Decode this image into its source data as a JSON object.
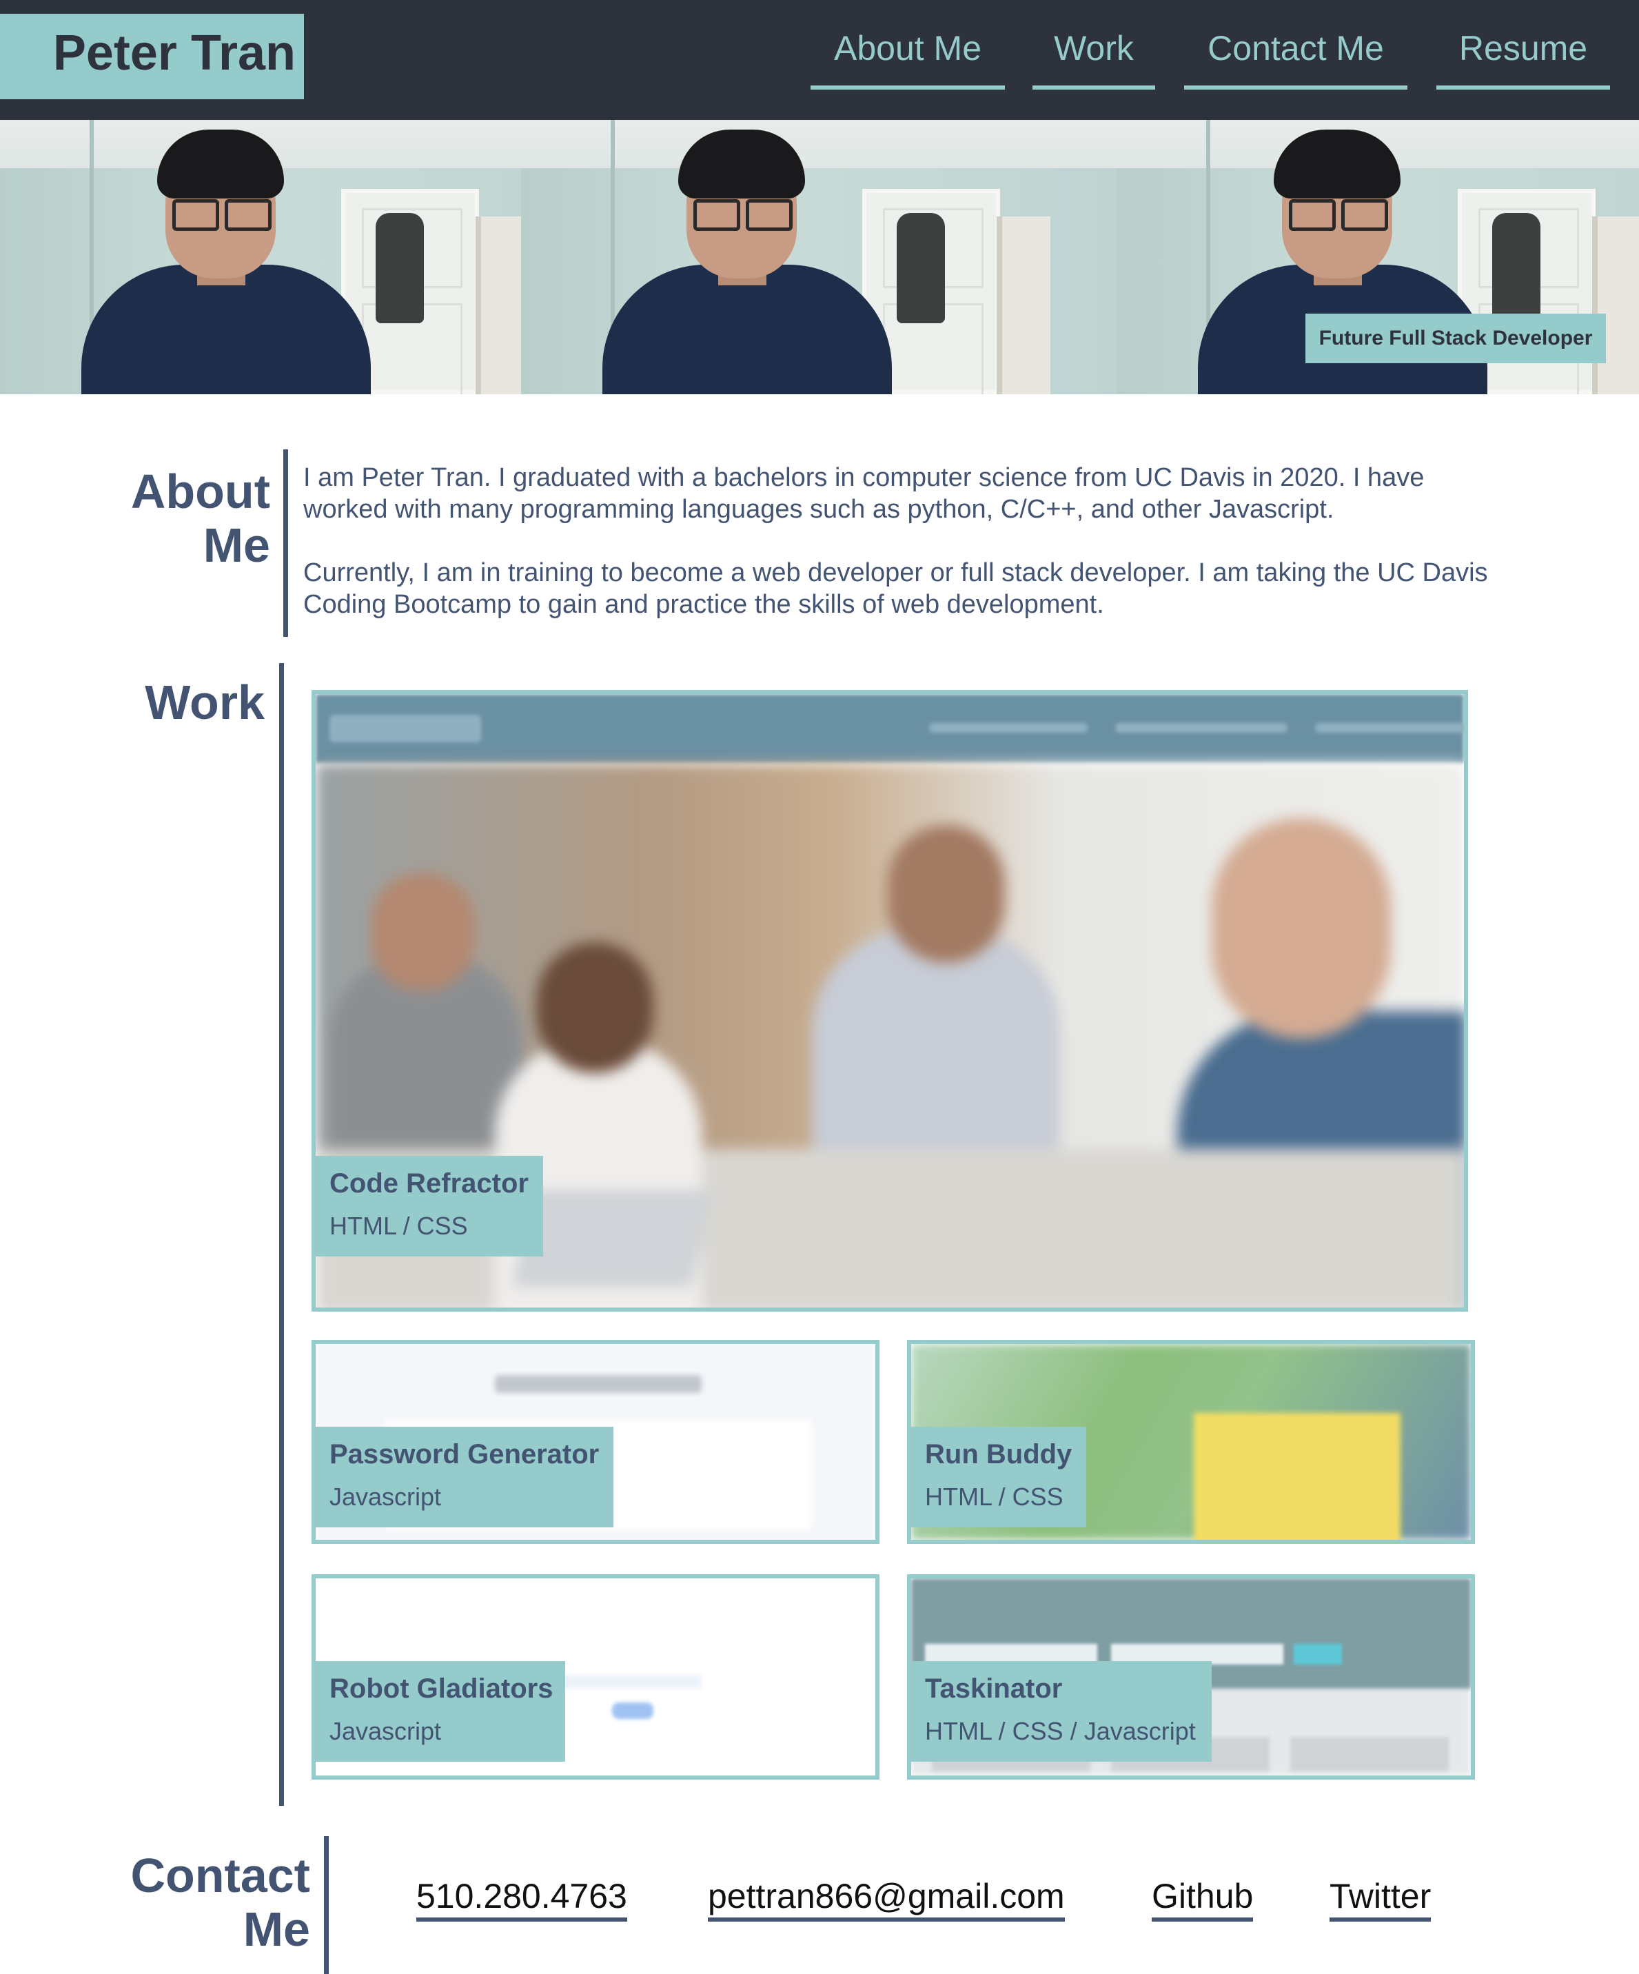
{
  "header": {
    "logo_text": "Peter Tran",
    "nav": [
      {
        "label": "About Me"
      },
      {
        "label": "Work"
      },
      {
        "label": "Contact Me"
      },
      {
        "label": "Resume"
      }
    ]
  },
  "hero": {
    "badge": "Future Full Stack Developer"
  },
  "about": {
    "title_line1": "About",
    "title_line2": "Me",
    "paragraphs": [
      "I am Peter Tran. I graduated with a bachelors in computer science from UC Davis in 2020. I have worked with many programming languages such as python, C/C++, and other Javascript.",
      "Currently, I am in training to become a web developer or full stack developer. I am taking the UC Davis Coding Bootcamp to gain and practice the skills of web development."
    ]
  },
  "work": {
    "title": "Work",
    "projects": [
      {
        "title": "Code Refractor",
        "tech": "HTML / CSS"
      },
      {
        "title": "Password Generator",
        "tech": "Javascript"
      },
      {
        "title": "Run Buddy",
        "tech": "HTML / CSS"
      },
      {
        "title": "Robot Gladiators",
        "tech": "Javascript"
      },
      {
        "title": "Taskinator",
        "tech": "HTML / CSS / Javascript"
      }
    ]
  },
  "contact": {
    "title_line1": "Contact",
    "title_line2": "Me",
    "links": [
      {
        "label": "510.280.4763"
      },
      {
        "label": "pettran866@gmail.com"
      },
      {
        "label": "Github"
      },
      {
        "label": "Twitter"
      }
    ]
  },
  "colors": {
    "header_bg": "#2e323c",
    "accent": "#96cbcb",
    "text": "#435472"
  }
}
